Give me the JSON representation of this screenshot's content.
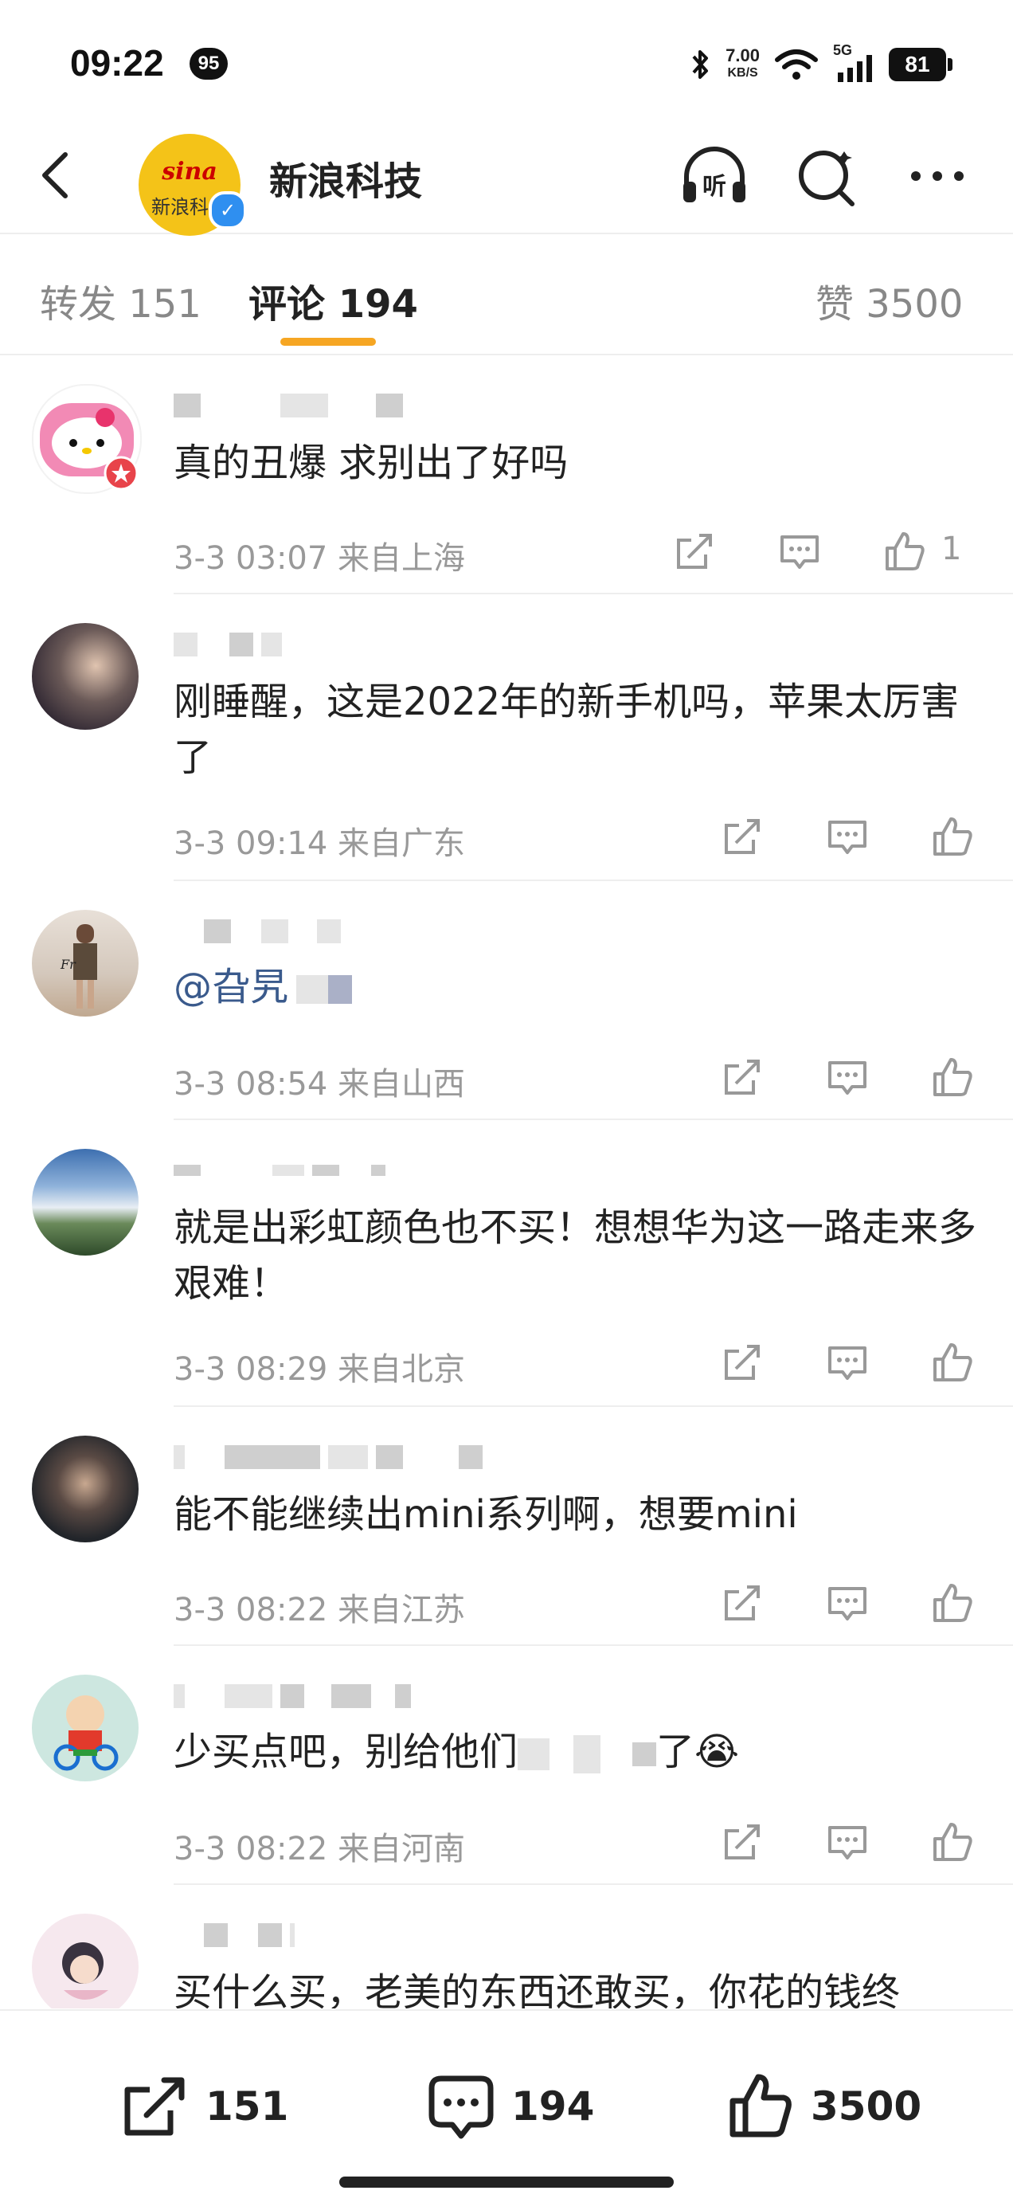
{
  "status": {
    "time": "09:22",
    "notification_count": "95",
    "net_speed": "7.00",
    "net_speed_unit": "KB/S",
    "network": "5G",
    "battery": "81"
  },
  "header": {
    "account_name": "新浪科技",
    "avatar_logo": "sina",
    "avatar_sub": "新浪科技"
  },
  "tabs": {
    "repost": "转发 151",
    "comments": "评论 194",
    "likes": "赞 3500"
  },
  "comments": [
    {
      "text": "真的丑爆 求别出了好吗",
      "time": "3-3 03:07",
      "location": "来自上海",
      "likes": "1"
    },
    {
      "text": "刚睡醒，这是2022年的新手机吗，苹果太厉害了",
      "time": "3-3 09:14",
      "location": "来自广东",
      "likes": ""
    },
    {
      "text": "@旮旯",
      "time": "3-3 08:54",
      "location": "来自山西",
      "likes": ""
    },
    {
      "text": "就是出彩虹颜色也不买！想想华为这一路走来多艰难！",
      "time": "3-3 08:29",
      "location": "来自北京",
      "likes": ""
    },
    {
      "text": "能不能继续出mini系列啊，想要mini",
      "time": "3-3 08:22",
      "location": "来自江苏",
      "likes": ""
    },
    {
      "text": "少买点吧，别给他们",
      "text_end": "了😭",
      "time": "3-3 08:22",
      "location": "来自河南",
      "likes": ""
    },
    {
      "text": "买什么买，老美的东西还敢买，你花的钱终",
      "time": "",
      "location": "",
      "likes": ""
    }
  ],
  "bottom": {
    "repost_count": "151",
    "comment_count": "194",
    "like_count": "3500"
  },
  "colors": {
    "accent": "#f6a623",
    "mention": "#3a5a8c",
    "verified": "#2f8ff0",
    "meta_text": "#999999"
  }
}
